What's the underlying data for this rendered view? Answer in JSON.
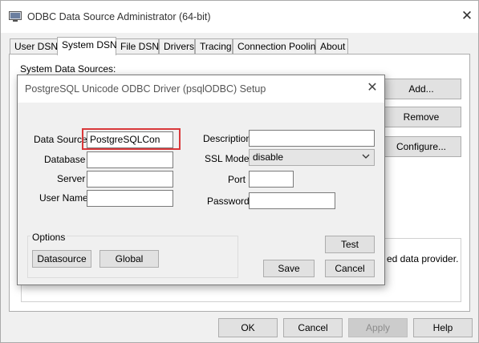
{
  "window": {
    "title": "ODBC Data Source Administrator (64-bit)",
    "close_symbol": "✕"
  },
  "tabs": [
    {
      "label": "User DSN",
      "active": false
    },
    {
      "label": "System DSN",
      "active": true
    },
    {
      "label": "File DSN",
      "active": false
    },
    {
      "label": "Drivers",
      "active": false
    },
    {
      "label": "Tracing",
      "active": false
    },
    {
      "label": "Connection Pooling",
      "active": false
    },
    {
      "label": "About",
      "active": false
    }
  ],
  "panel": {
    "label": "System Data Sources:",
    "add_label": "Add...",
    "remove_label": "Remove",
    "configure_label": "Configure...",
    "info_text": "ed data provider."
  },
  "footer": {
    "ok_label": "OK",
    "cancel_label": "Cancel",
    "apply_label": "Apply",
    "help_label": "Help"
  },
  "dialog": {
    "title": "PostgreSQL Unicode ODBC Driver (psqlODBC) Setup",
    "close_symbol": "✕",
    "data_source_label": "Data Source",
    "data_source_value": "PostgreSQLCon",
    "database_label": "Database",
    "database_value": "",
    "server_label": "Server",
    "server_value": "",
    "user_name_label": "User Name",
    "user_name_value": "",
    "description_label": "Description",
    "description_value": "",
    "ssl_mode_label": "SSL Mode",
    "ssl_mode_value": "disable",
    "port_label": "Port",
    "port_value": "",
    "password_label": "Password",
    "password_value": "",
    "options_label": "Options",
    "datasource_button": "Datasource",
    "global_button": "Global",
    "test_button": "Test",
    "save_button": "Save",
    "cancel_button": "Cancel"
  },
  "colors": {
    "highlight_border": "#d9383a",
    "window_bg": "#f0f0f0",
    "button_bg": "#e1e1e1"
  }
}
